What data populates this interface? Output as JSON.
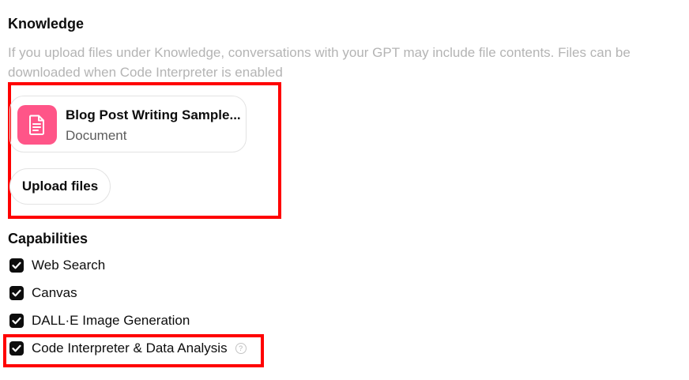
{
  "knowledge": {
    "title": "Knowledge",
    "description": "If you upload files under Knowledge, conversations with your GPT may include file contents. Files can be downloaded when Code Interpreter is enabled",
    "files": [
      {
        "name": "Blog Post Writing Sample...",
        "type": "Document",
        "icon": "document-icon"
      }
    ],
    "upload_label": "Upload files"
  },
  "capabilities": {
    "title": "Capabilities",
    "items": [
      {
        "label": "Web Search",
        "checked": true
      },
      {
        "label": "Canvas",
        "checked": true
      },
      {
        "label": "DALL·E Image Generation",
        "checked": true
      },
      {
        "label": "Code Interpreter & Data Analysis",
        "checked": true,
        "help_icon": "?"
      }
    ]
  },
  "colors": {
    "file_icon_bg": "#ff5588",
    "highlight": "#ff0000",
    "checkbox": "#0d0d0d",
    "muted_text": "#b4b4b4"
  }
}
